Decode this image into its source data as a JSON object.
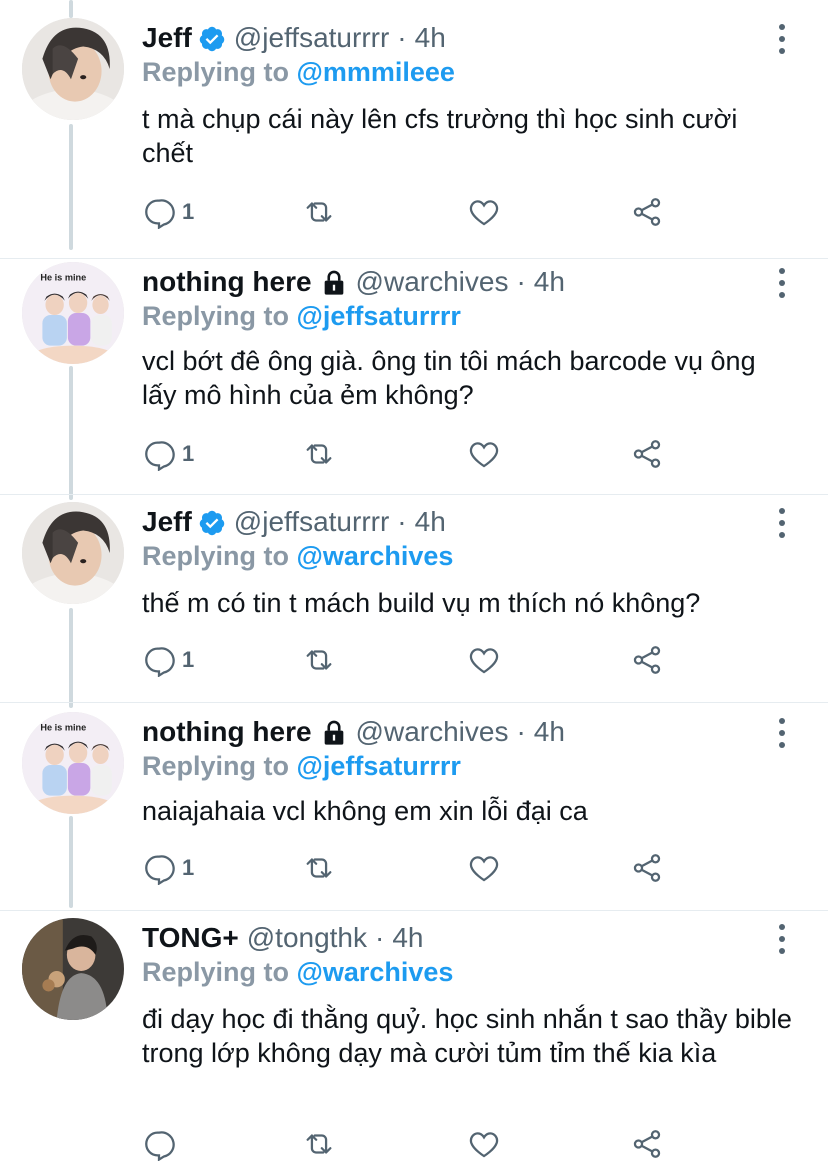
{
  "tweets": [
    {
      "name": "Jeff",
      "verified": true,
      "locked": false,
      "handle": "@jeffsaturrrr",
      "dot": "·",
      "time": "4h",
      "replying_label": "Replying to",
      "replying_to": "@mmmileee",
      "text": "t mà chụp cái này lên cfs trường thì học sinh cười chết",
      "reply_count": "1",
      "avatar_label": ""
    },
    {
      "name": "nothing here",
      "verified": false,
      "locked": true,
      "handle": "@warchives",
      "dot": "·",
      "time": "4h",
      "replying_label": "Replying to",
      "replying_to": "@jeffsaturrrr",
      "text": "vcl bớt đê ông già. ông tin tôi mách barcode vụ ông lấy mô hình của ẻm không?",
      "reply_count": "1",
      "avatar_label": "He is mine"
    },
    {
      "name": "Jeff",
      "verified": true,
      "locked": false,
      "handle": "@jeffsaturrrr",
      "dot": "·",
      "time": "4h",
      "replying_label": "Replying to",
      "replying_to": "@warchives",
      "text": "thế m có tin t mách build vụ m thích nó không?",
      "reply_count": "1",
      "avatar_label": ""
    },
    {
      "name": "nothing here",
      "verified": false,
      "locked": true,
      "handle": "@warchives",
      "dot": "·",
      "time": "4h",
      "replying_label": "Replying to",
      "replying_to": "@jeffsaturrrr",
      "text": "naiajahaia vcl không em xin lỗi đại ca",
      "reply_count": "1",
      "avatar_label": "He is mine"
    },
    {
      "name": "TONG+",
      "verified": false,
      "locked": false,
      "handle": "@tongthk",
      "dot": "·",
      "time": "4h",
      "replying_label": "Replying to",
      "replying_to": "@warchives",
      "text": "đi dạy học đi thằng quỷ. học sinh nhắn t sao thầy bible trong lớp không dạy mà cười tủm tỉm thế kia kìa",
      "reply_count": "",
      "avatar_label": ""
    }
  ],
  "icons": {
    "reply": "reply-icon",
    "retweet": "retweet-icon",
    "like": "heart-icon",
    "share": "share-icon",
    "more": "more-icon",
    "verified": "verified-badge-icon",
    "lock": "lock-icon"
  },
  "colors": {
    "accent": "#1d9bf0",
    "secondary_text": "#536471",
    "replying_label": "#8a98a5",
    "thread_line": "#cfd9de"
  }
}
